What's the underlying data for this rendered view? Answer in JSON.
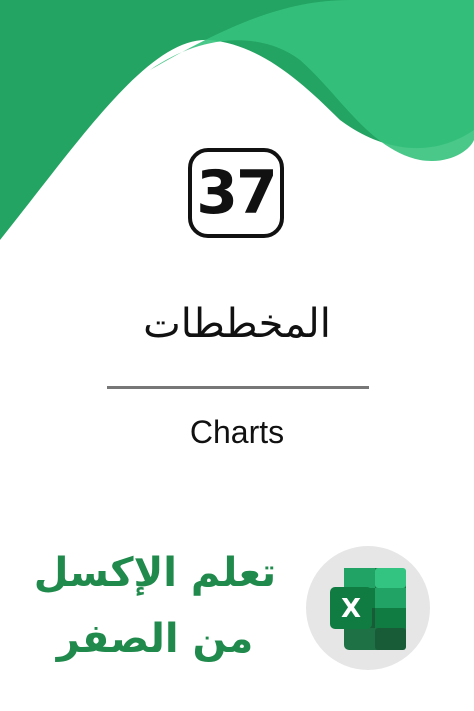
{
  "lesson": {
    "number": "37",
    "title_ar": "المخططات",
    "title_en": "Charts"
  },
  "tagline": {
    "line1": "تعلم الإكسل",
    "line2": "من الصفر"
  },
  "excel_icon": {
    "letter": "X"
  },
  "colors": {
    "header_green_dark": "#23a462",
    "header_green_light": "#35c27c",
    "tagline_green": "#1f8a4c",
    "excel_green": "#1e7145",
    "text_dark": "#111111",
    "divider_gray": "#777777",
    "badge_gray": "#e6e6e6"
  },
  "icons": [
    "excel-icon"
  ]
}
